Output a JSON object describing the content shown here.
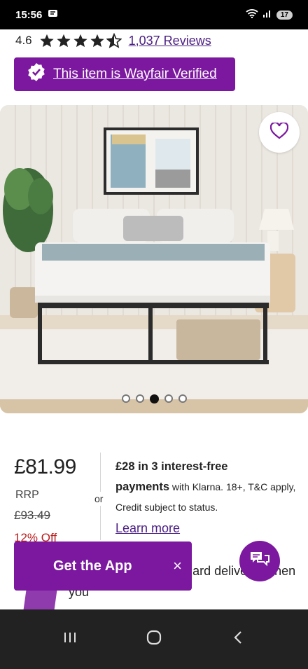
{
  "status_bar": {
    "time": "15:56",
    "battery": "17"
  },
  "rating": {
    "value": "4.6",
    "stars": 4.5,
    "reviews_link": "1,037 Reviews"
  },
  "verified_banner": {
    "label": "This item is Wayfair Verified"
  },
  "gallery": {
    "image_count": 5,
    "active_index": 2
  },
  "pricing": {
    "price": "£81.99",
    "rrp_label": "RRP",
    "rrp_value": "£93.49",
    "discount": "12% Off",
    "or_label": "or",
    "klarna_bold_1": "£28 in 3 interest-free",
    "klarna_bold_2": "payments",
    "klarna_rest": " with Klarna. 18+, T&C apply, Credit subject to status.",
    "learn_more": "Learn more"
  },
  "rewards": {
    "text_visible": "wards to   us free standard delivery² when you"
  },
  "get_app": {
    "label": "Get the App",
    "close": "×"
  },
  "colors": {
    "brand_purple": "#7b189f",
    "link_purple": "#4a1e82",
    "discount_red": "#b91c1c"
  },
  "icons": [
    "wifi-icon",
    "signal-icon",
    "star-icon",
    "verified-check-icon",
    "heart-icon",
    "chat-icon",
    "nav-recents-icon",
    "nav-home-icon",
    "nav-back-icon"
  ]
}
